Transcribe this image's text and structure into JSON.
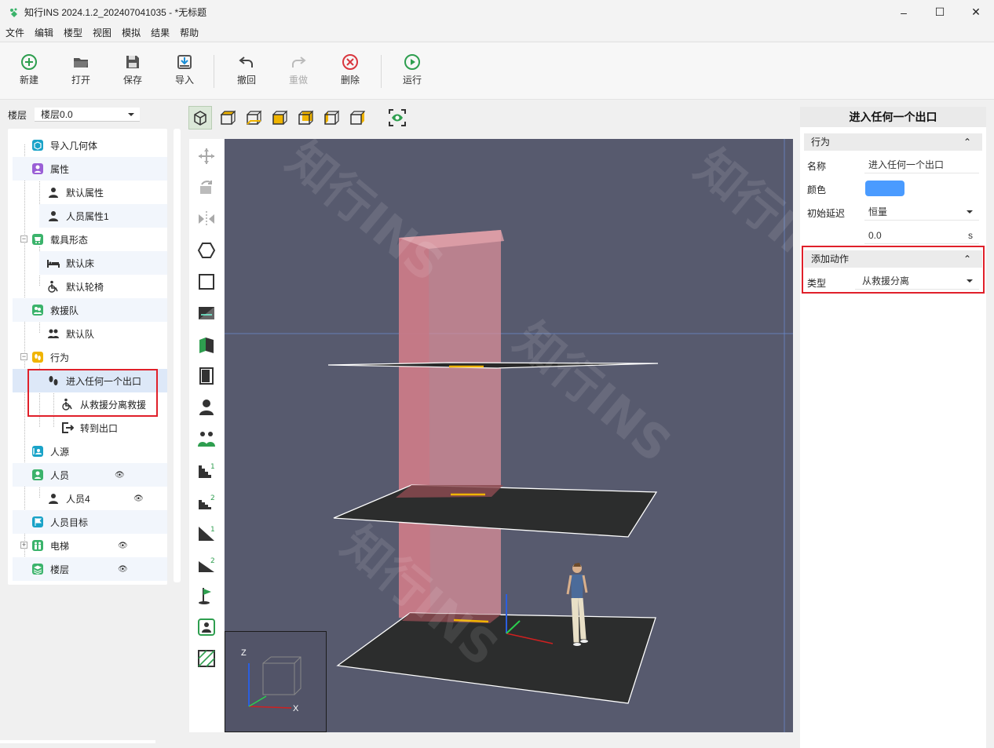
{
  "window": {
    "title": "知行INS 2024.1.2_202407041035 - *无标题",
    "minimize": "–",
    "maximize": "☐",
    "close": "✕"
  },
  "menu": [
    "文件",
    "编辑",
    "楼型",
    "视图",
    "模拟",
    "结果",
    "帮助"
  ],
  "toolbar": {
    "new": "新建",
    "open": "打开",
    "save": "保存",
    "import": "导入",
    "undo": "撤回",
    "redo": "重做",
    "delete": "删除",
    "run": "运行"
  },
  "floor_selector": {
    "label": "楼层",
    "value": "楼层0.0"
  },
  "tree": {
    "import_geometry": "导入几何体",
    "attributes": "属性",
    "default_attr": "默认属性",
    "person_attr1": "人员属性1",
    "carrier_shape": "载具形态",
    "default_bed": "默认床",
    "default_wheelchair": "默认轮椅",
    "rescue_team": "救援队",
    "default_team": "默认队",
    "behavior": "行为",
    "enter_any_exit": "进入任何一个出口",
    "separate_from_rescue": "从救援分离救援",
    "go_to_exit": "转到出口",
    "person_source": "人源",
    "persons": "人员",
    "person4": "人员4",
    "person_target": "人员目标",
    "elevator": "电梯",
    "floors": "楼层"
  },
  "right_panel": {
    "title": "进入任何一个出口",
    "behavior_section": "行为",
    "name_label": "名称",
    "name_value": "进入任何一个出口",
    "color_label": "颜色",
    "color_value": "#4a9bff",
    "delay_label": "初始延迟",
    "delay_type": "恒量",
    "delay_value": "0.0",
    "delay_unit": "s",
    "add_action_section": "添加动作",
    "type_label": "类型",
    "type_value": "从救援分离"
  },
  "axes": {
    "z": "Z",
    "x": "X"
  },
  "watermark": "知行INS",
  "colors": {
    "viewport_bg": "#575a6e",
    "highlight": "#e0202a",
    "accent": "#4a9bff"
  }
}
